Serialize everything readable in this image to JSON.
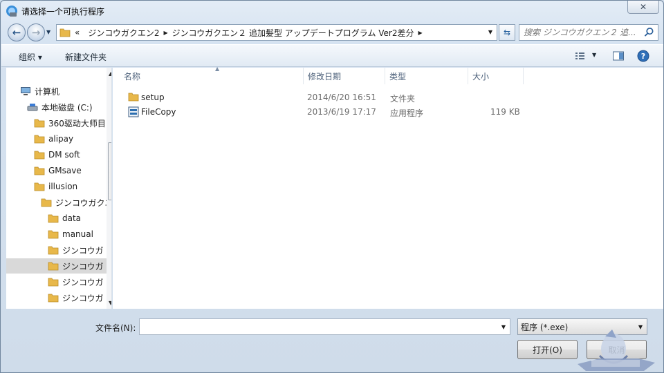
{
  "window": {
    "title": "请选择一个可执行程序",
    "close_label": "✕"
  },
  "address": {
    "overflow": "«",
    "segments": [
      "ジンコウガクエン2",
      "ジンコウガクエン２ 追加髪型 アップデートプログラム Ver2差分"
    ]
  },
  "search": {
    "placeholder": "搜索 ジンコウガクエン２ 追..."
  },
  "toolbar": {
    "organize_label": "组织 ▾",
    "new_folder_label": "新建文件夹"
  },
  "nav": {
    "computer": "计算机",
    "drive": "本地磁盘 (C:)",
    "folders": [
      "360驱动大师目",
      "alipay",
      "DM soft",
      "GMsave",
      "illusion"
    ],
    "sub": "ジンコウガクエ",
    "subfolders": [
      "data",
      "manual",
      "ジンコウガ",
      "ジンコウガ",
      "ジンコウガ",
      "ジンコウガ"
    ]
  },
  "columns": {
    "name": "名称",
    "date": "修改日期",
    "type": "类型",
    "size": "大小"
  },
  "files": [
    {
      "name": "setup",
      "date": "2014/6/20 16:51",
      "type": "文件夹",
      "size": ""
    },
    {
      "name": "FileCopy",
      "date": "2013/6/19 17:17",
      "type": "应用程序",
      "size": "119 KB"
    }
  ],
  "bottom": {
    "filename_label": "文件名(N):",
    "filename_value": "",
    "filetype": "程序 (*.exe)",
    "open_label": "打开(O)",
    "cancel_label": "取消"
  },
  "icons": {
    "back": "arrow-left-icon",
    "forward": "arrow-right-icon",
    "refresh": "refresh-icon",
    "search": "search-icon",
    "views": "view-options-icon",
    "preview": "preview-pane-icon",
    "help": "help-icon"
  },
  "colors": {
    "folder": "#e8b84a",
    "window_frame": "#cfdcea",
    "selected": "#d9d9d9"
  }
}
